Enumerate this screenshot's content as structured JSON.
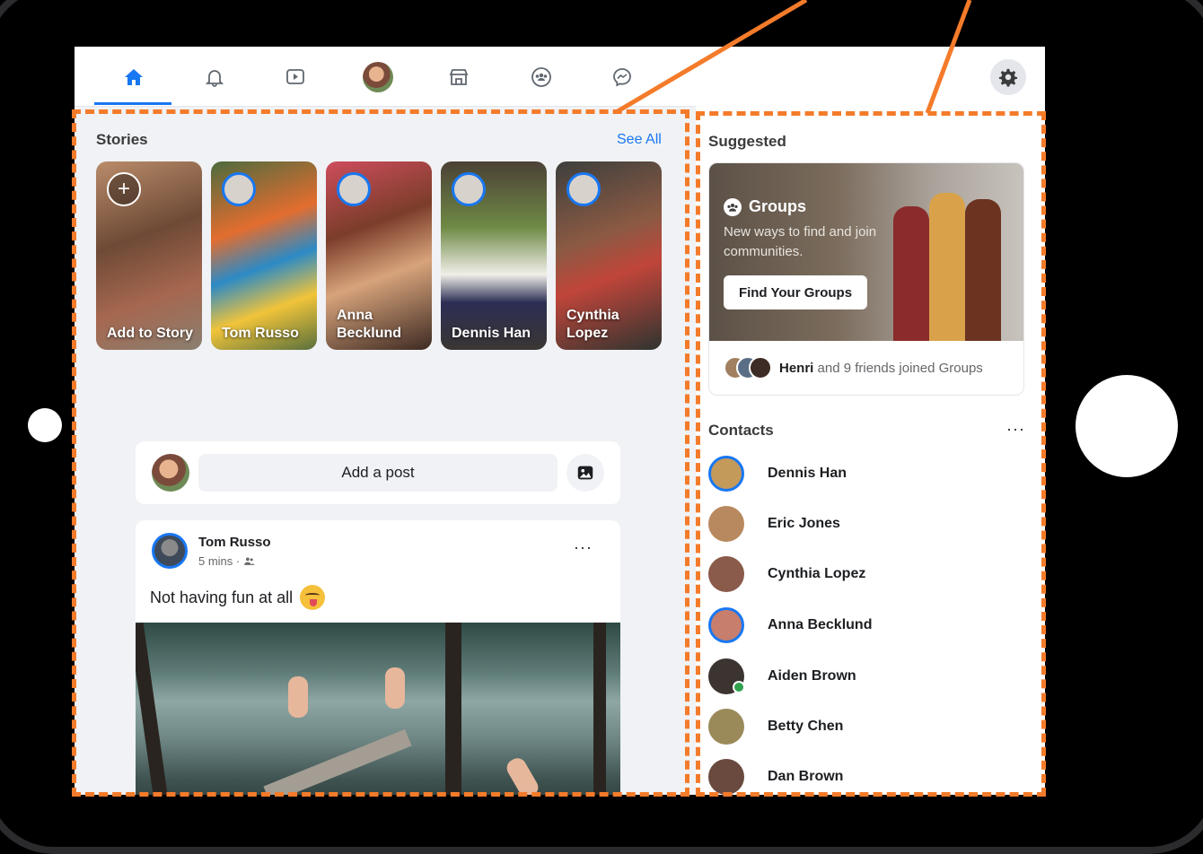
{
  "colors": {
    "accent": "#1877f2",
    "callout": "#f47b2a",
    "online": "#31a24c"
  },
  "nav": {
    "items": [
      {
        "icon": "home-icon"
      },
      {
        "icon": "bell-icon"
      },
      {
        "icon": "video-icon"
      },
      {
        "icon": "profile-avatar"
      },
      {
        "icon": "marketplace-icon"
      },
      {
        "icon": "groups-icon"
      },
      {
        "icon": "messenger-icon"
      }
    ],
    "settings_icon": "gear-icon"
  },
  "stories": {
    "title": "Stories",
    "see_all": "See All",
    "items": [
      {
        "name": "Add to Story"
      },
      {
        "name": "Tom Russo"
      },
      {
        "name": "Anna Becklund"
      },
      {
        "name": "Dennis Han"
      },
      {
        "name": "Cynthia Lopez"
      }
    ]
  },
  "composer": {
    "placeholder": "Add a post",
    "photo_icon": "photo-icon"
  },
  "post": {
    "author": "Tom Russo",
    "time": "5 mins ·",
    "audience_icon": "friends-icon",
    "text": "Not having fun at all",
    "more": "···"
  },
  "suggested": {
    "title": "Suggested",
    "groups_title": "Groups",
    "groups_subtitle": "New ways to find and join communities.",
    "button": "Find Your Groups",
    "footer_name": "Henri",
    "footer_text": " and 9 friends joined Groups"
  },
  "contacts": {
    "title": "Contacts",
    "more": "···",
    "items": [
      {
        "name": "Dennis Han"
      },
      {
        "name": "Eric Jones"
      },
      {
        "name": "Cynthia Lopez"
      },
      {
        "name": "Anna Becklund"
      },
      {
        "name": "Aiden Brown"
      },
      {
        "name": "Betty Chen"
      },
      {
        "name": "Dan Brown"
      }
    ]
  }
}
